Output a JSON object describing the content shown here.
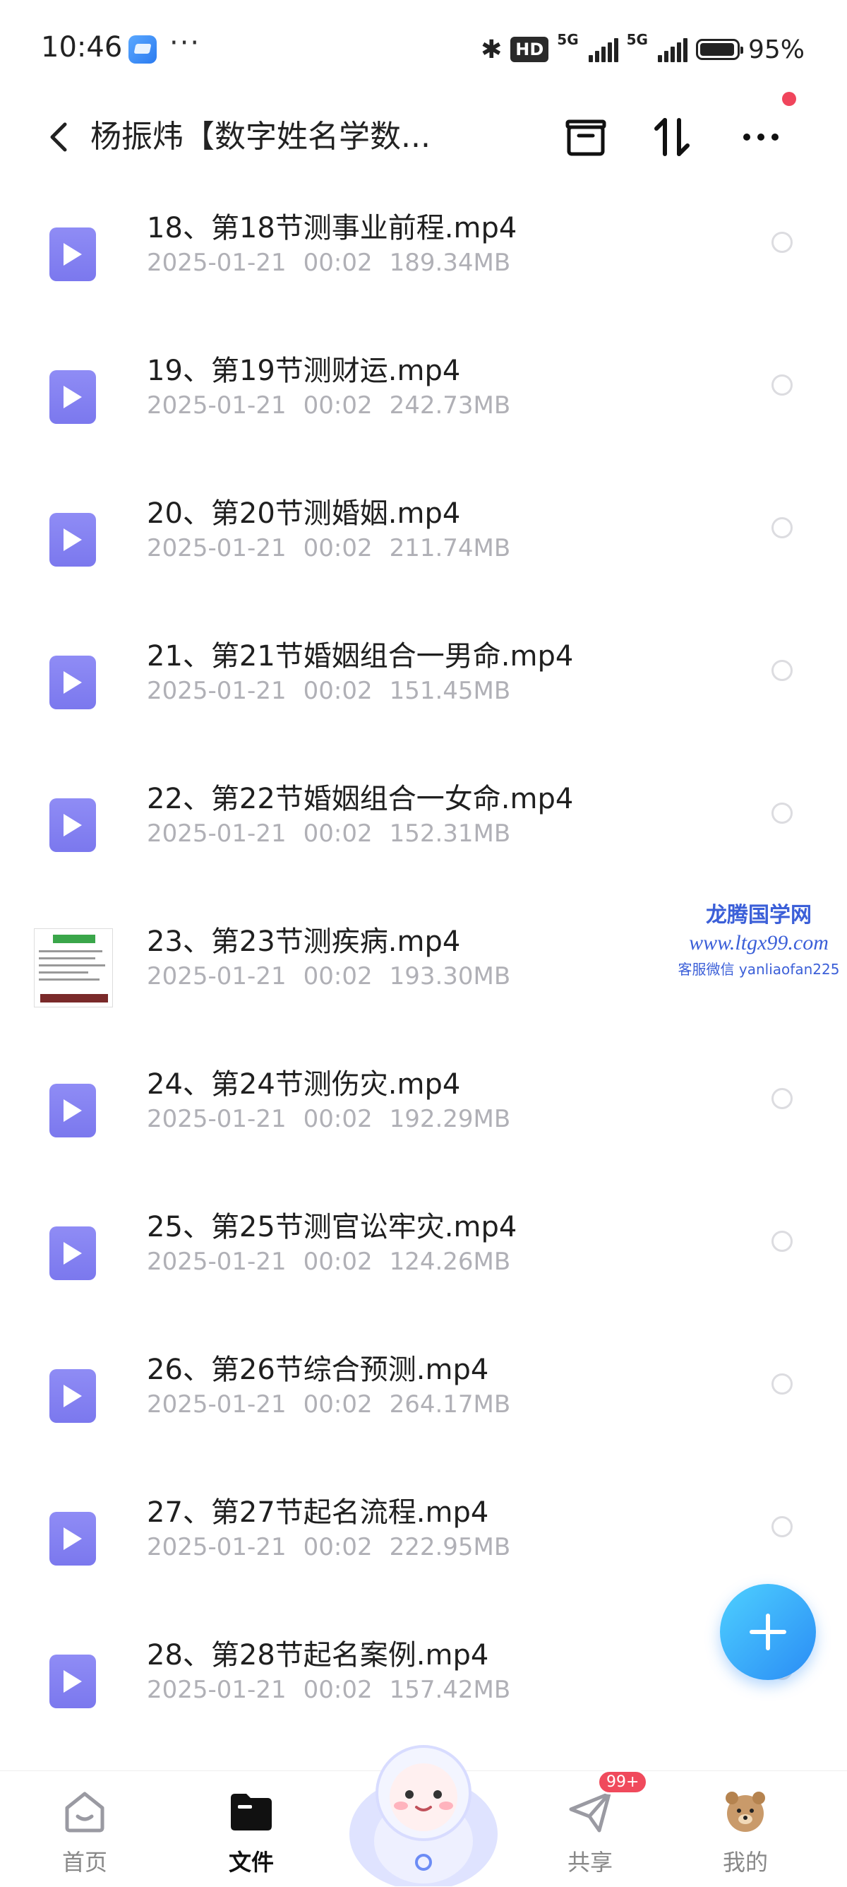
{
  "status_bar": {
    "time": "10:46",
    "more": "···",
    "hd_label": "HD",
    "network_1": "5G",
    "network_2": "5G",
    "battery_percent": "95%",
    "icons": [
      "app-icon",
      "bluetooth-icon",
      "signal-icon",
      "battery-icon"
    ]
  },
  "header": {
    "title": "杨振炜【数字姓名学数...",
    "icons": [
      "back-icon",
      "archive-icon",
      "sort-icon",
      "more-menu-icon"
    ],
    "notification_dot_color": "#f0455c"
  },
  "files": [
    {
      "name": "18、第18节测事业前程.mp4",
      "date": "2025-01-21",
      "time": "00:02",
      "size": "189.34MB",
      "thumbnail": false
    },
    {
      "name": "19、第19节测财运.mp4",
      "date": "2025-01-21",
      "time": "00:02",
      "size": "242.73MB",
      "thumbnail": false
    },
    {
      "name": "20、第20节测婚姻.mp4",
      "date": "2025-01-21",
      "time": "00:02",
      "size": "211.74MB",
      "thumbnail": false
    },
    {
      "name": "21、第21节婚姻组合一男命.mp4",
      "date": "2025-01-21",
      "time": "00:02",
      "size": "151.45MB",
      "thumbnail": false
    },
    {
      "name": "22、第22节婚姻组合一女命.mp4",
      "date": "2025-01-21",
      "time": "00:02",
      "size": "152.31MB",
      "thumbnail": false
    },
    {
      "name": "23、第23节测疾病.mp4",
      "date": "2025-01-21",
      "time": "00:02",
      "size": "193.30MB",
      "thumbnail": true
    },
    {
      "name": "24、第24节测伤灾.mp4",
      "date": "2025-01-21",
      "time": "00:02",
      "size": "192.29MB",
      "thumbnail": false
    },
    {
      "name": "25、第25节测官讼牢灾.mp4",
      "date": "2025-01-21",
      "time": "00:02",
      "size": "124.26MB",
      "thumbnail": false
    },
    {
      "name": "26、第26节综合预测.mp4",
      "date": "2025-01-21",
      "time": "00:02",
      "size": "264.17MB",
      "thumbnail": false
    },
    {
      "name": "27、第27节起名流程.mp4",
      "date": "2025-01-21",
      "time": "00:02",
      "size": "222.95MB",
      "thumbnail": false
    },
    {
      "name": "28、第28节起名案例.mp4",
      "date": "2025-01-21",
      "time": "00:02",
      "size": "157.42MB",
      "thumbnail": false
    }
  ],
  "watermark": {
    "line1": "龙腾国学网",
    "line2": "www.ltgx99.com",
    "line3": "客服微信 yanliaofan225"
  },
  "fab": {
    "icon": "plus-icon",
    "colors": [
      "#4ed0ff",
      "#2a8cf5"
    ]
  },
  "bottom_nav": {
    "tabs": [
      {
        "label": "首页",
        "icon": "home-icon",
        "active": false
      },
      {
        "label": "文件",
        "icon": "folder-icon",
        "active": true
      },
      {
        "label": "共享",
        "icon": "share-icon",
        "active": false,
        "badge": "99+"
      },
      {
        "label": "我的",
        "icon": "profile-avatar-icon",
        "active": false
      }
    ],
    "center_icon": "mascot-icon"
  },
  "colors": {
    "file_icon": "#8582f2",
    "meta_text": "#b0b0b6",
    "accent": "#2a8cf5",
    "badge": "#f04a5c"
  }
}
